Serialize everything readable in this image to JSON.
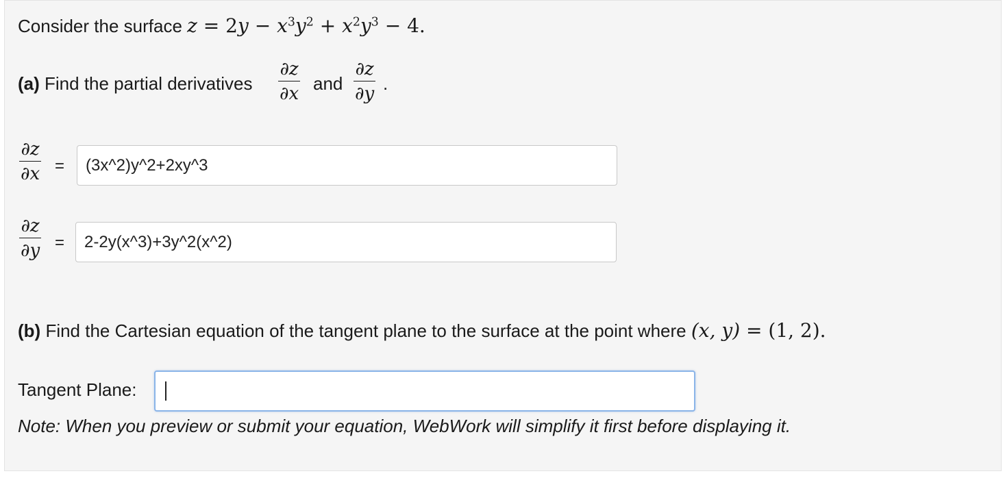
{
  "intro": {
    "prefix": "Consider the surface"
  },
  "part_a": {
    "label": "(a)",
    "text": "Find the partial derivatives",
    "and": "and",
    "period": ".",
    "dzdx_num": "∂z",
    "dzdx_den": "∂x",
    "dzdy_num": "∂z",
    "dzdy_den": "∂y",
    "equals": "="
  },
  "answers": {
    "dzdx_value": "(3x^2)y^2+2xy^3",
    "dzdy_value": "2-2y(x^3)+3y^2(x^2)"
  },
  "part_b": {
    "label": "(b)",
    "text": "Find the Cartesian equation of the tangent plane to the surface at the point where"
  },
  "tangent_plane": {
    "label": "Tangent Plane:",
    "value": ""
  },
  "note": "Note: When you preview or submit your equation, WebWork will simplify it first before displaying it."
}
